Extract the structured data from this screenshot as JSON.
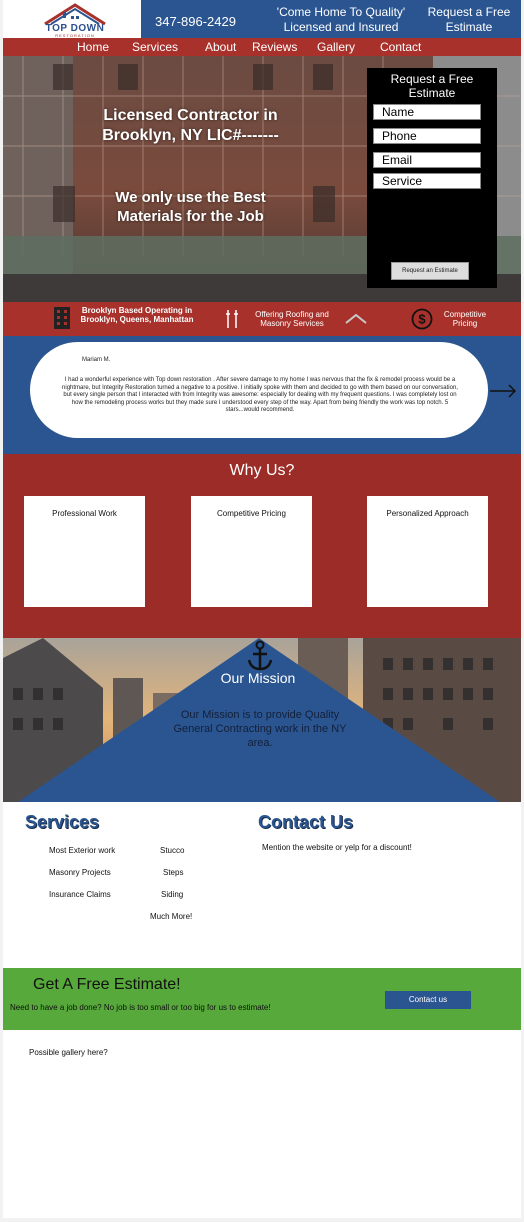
{
  "logo": {
    "name": "TOP DOWN",
    "sub": "RESTORATION"
  },
  "header": {
    "phone": "347-896-2429",
    "tagline": "'Come Home To Quality' Licensed and Insured",
    "cta": "Request a Free Estimate"
  },
  "nav": [
    "Home",
    "Services",
    "About",
    "Reviews",
    "Gallery",
    "Contact"
  ],
  "hero": {
    "headline": "Licensed Contractor in Brooklyn, NY LIC#-------",
    "subheadline": "We only use the Best Materials for the Job"
  },
  "estimate_form": {
    "title": "Request a Free Estimate",
    "fields": [
      "Name",
      "Phone",
      "Email",
      "Service"
    ],
    "button": "Request an Estimate"
  },
  "features": {
    "location": "Brooklyn Based Operating in Brooklyn, Queens, Manhattan",
    "services": "Offering Roofing and Masonry Services",
    "pricing": "Competitive Pricing"
  },
  "testimonial": {
    "name": "Mariam M.",
    "quote": "I had a wonderful experience with Top down restoration . After severe damage to my home I was nervous that the fix & remodel process would be a nightmare, but Integrity Restoration turned a negative to a positive. I initially spoke with them and decided to go with them based on our conversation, but every single person that I interacted with from Integrity was awesome: especially for dealing with my frequent questions. I was completely lost on how the remodeling process works but they made sure I understood every step of the way. Apart from being friendly the work was top notch. 5 stars...would recommend."
  },
  "why_us": {
    "title": "Why Us?",
    "cards": [
      "Professional Work",
      "Competitive Pricing",
      "Personalized Approach"
    ]
  },
  "mission": {
    "title": "Our Mission",
    "text": "Our Mission is to provide Quality General Contracting work in the NY area."
  },
  "services": {
    "title": "Services",
    "items": [
      "Most Exterior work",
      "Stucco",
      "Masonry Projects",
      "Steps",
      "Insurance Claims",
      "Siding",
      "Much More!"
    ]
  },
  "contact": {
    "title": "Contact Us",
    "text": "Mention the website or yelp for a discount!"
  },
  "estimate_banner": {
    "title": "Get A Free Estimate!",
    "subtitle": "Need to have a job done? No job is too small or too big for us to estimate!",
    "button": "Contact us"
  },
  "gallery_note": "Possible gallery here?",
  "colors": {
    "blue": "#2b5590",
    "red": "#a8312b",
    "green": "#56a93a",
    "black": "#000000"
  }
}
